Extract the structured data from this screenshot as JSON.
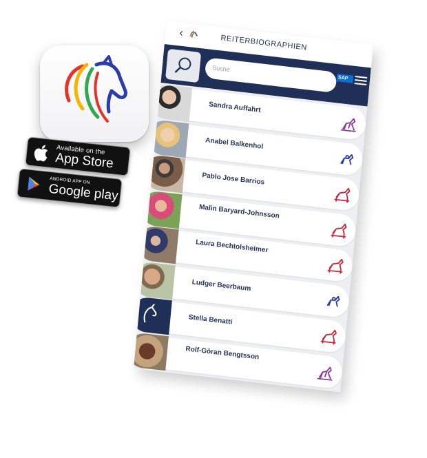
{
  "header": {
    "back_glyph": "‹",
    "title": "REITERBIOGRAPHIEN"
  },
  "search": {
    "placeholder": "Suche"
  },
  "sponsor": {
    "label": "SAP"
  },
  "badges": {
    "apple_small": "Available on the",
    "apple_big": "App Store",
    "google_small": "ANDROID APP ON",
    "google_big": "Google play"
  },
  "colors": {
    "navy": "#1f2f57",
    "dressage": "#8b3a9c",
    "jumping": "#c8263a",
    "eventing": "#2b3ea8"
  },
  "riders": [
    {
      "name": "Sandra Auffahrt",
      "discipline": "dressage-icon",
      "color": "#8b3a9c"
    },
    {
      "name": "Anabel Balkenhol",
      "discipline": "para-icon",
      "color": "#2b3ea8"
    },
    {
      "name": "Pablo Jose Barrios",
      "discipline": "jumping-icon",
      "color": "#c8263a"
    },
    {
      "name": "Malin Baryard-Johnsson",
      "discipline": "jumping-icon",
      "color": "#c8263a"
    },
    {
      "name": "Laura Bechtolsheimer",
      "discipline": "jumping-icon",
      "color": "#c8263a"
    },
    {
      "name": "Ludger Beerbaum",
      "discipline": "para-icon",
      "color": "#2b3ea8"
    },
    {
      "name": "Stella Benatti",
      "discipline": "jumping-icon",
      "color": "#c8263a"
    },
    {
      "name": "Rolf-Göran Bengtsson",
      "discipline": "dressage-icon",
      "color": "#8b3a9c"
    },
    {
      "name": "",
      "discipline": "jumping-icon",
      "color": "#c8263a"
    }
  ]
}
